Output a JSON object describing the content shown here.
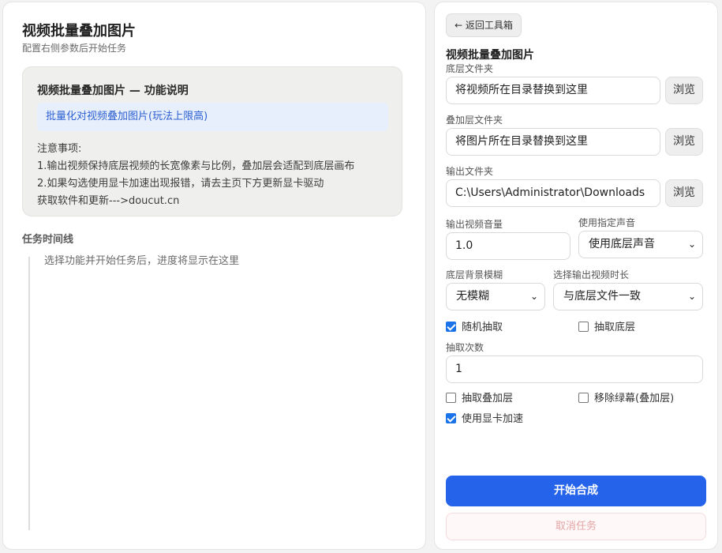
{
  "left": {
    "title": "视频批量叠加图片",
    "subtitle": "配置右侧参数后开始任务",
    "info": {
      "title": "视频批量叠加图片 — 功能说明",
      "highlight": "批量化对视频叠加图片(玩法上限高)",
      "notes": [
        "注意事项:",
        "1.输出视频保持底层视频的长宽像素与比例，叠加层会适配到底层画布",
        "2.如果勾选使用显卡加速出现报错，请去主页下方更新显卡驱动",
        "获取软件和更新--->doucut.cn"
      ]
    },
    "timeline": {
      "title": "任务时间线",
      "empty_text": "选择功能并开始任务后，进度将显示在这里"
    }
  },
  "right": {
    "back_label": "← 返回工具箱",
    "tool_title": "视频批量叠加图片",
    "base_folder": {
      "label": "底层文件夹",
      "value": "将视频所在目录替换到这里",
      "browse": "浏览"
    },
    "overlay_folder": {
      "label": "叠加层文件夹",
      "value": "将图片所在目录替换到这里",
      "browse": "浏览"
    },
    "output_folder": {
      "label": "输出文件夹",
      "value": "C:\\Users\\Administrator\\Downloads",
      "browse": "浏览"
    },
    "volume": {
      "label": "输出视频音量",
      "value": "1.0"
    },
    "audio_source": {
      "label": "使用指定声音",
      "value": "使用底层声音"
    },
    "blur": {
      "label": "底层背景模糊",
      "value": "无模糊"
    },
    "duration": {
      "label": "选择输出视频时长",
      "value": "与底层文件一致"
    },
    "random_pick": {
      "label": "随机抽取",
      "checked": true
    },
    "pick_base": {
      "label": "抽取底层",
      "checked": false
    },
    "pick_count": {
      "label": "抽取次数",
      "value": "1"
    },
    "pick_overlay": {
      "label": "抽取叠加层",
      "checked": false
    },
    "remove_green": {
      "label": "移除绿幕(叠加层)",
      "checked": false
    },
    "gpu_accel": {
      "label": "使用显卡加速",
      "checked": true
    },
    "start_label": "开始合成",
    "cancel_label": "取消任务"
  },
  "colors": {
    "accent": "#2563eb",
    "highlight_bg": "#e7effd",
    "cancel_text": "#e3a5a5"
  }
}
